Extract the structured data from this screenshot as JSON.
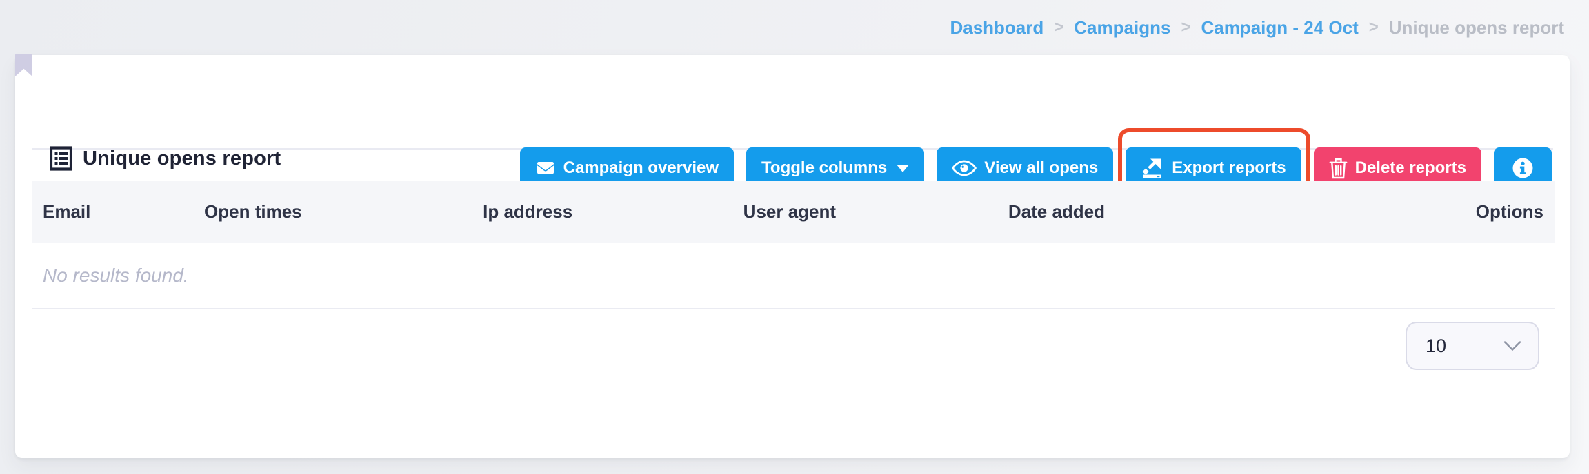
{
  "breadcrumb": {
    "separator": ">",
    "items": [
      {
        "label": "Dashboard"
      },
      {
        "label": "Campaigns"
      },
      {
        "label": "Campaign - 24 Oct"
      },
      {
        "label": "Unique opens report"
      }
    ]
  },
  "page": {
    "title": "Unique opens report"
  },
  "toolbar": {
    "campaign_overview_label": "Campaign overview",
    "toggle_columns_label": "Toggle columns",
    "view_all_opens_label": "View all opens",
    "export_reports_label": "Export reports",
    "delete_reports_label": "Delete reports"
  },
  "table": {
    "columns": [
      "Email",
      "Open times",
      "Ip address",
      "User agent",
      "Date added",
      "Options"
    ],
    "empty_message": "No results found.",
    "rows": []
  },
  "pagination": {
    "page_size": "10"
  },
  "icons": {
    "title": "list-report-icon",
    "buttons": [
      "envelope-icon",
      "caret-down-icon",
      "eye-icon",
      "export-icon",
      "trash-icon",
      "info-circle-icon"
    ]
  },
  "colors": {
    "primary": "#149cec",
    "danger": "#f2436e",
    "highlight_ring": "#ed4b2b",
    "breadcrumb_link": "#4aa4e6",
    "breadcrumb_current": "#b9bdc6",
    "table_header_bg": "#f5f6f9",
    "empty_text": "#b5b8ca"
  }
}
